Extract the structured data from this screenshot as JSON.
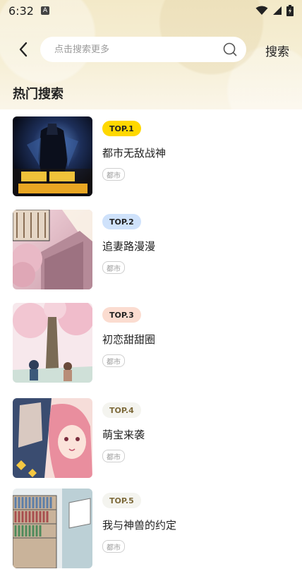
{
  "status_bar": {
    "time": "6:32",
    "notification_badge": "A"
  },
  "header": {
    "back_icon": "chevron-left-icon",
    "search_placeholder": "点击搜索更多",
    "search_icon": "search-icon",
    "search_button_label": "搜索"
  },
  "section": {
    "title": "热门搜索"
  },
  "hot_list": [
    {
      "rank": "TOP.1",
      "title": "都市无敌战神",
      "tag": "都市",
      "rank_bg": "#ffd800",
      "rank_color": "#222222"
    },
    {
      "rank": "TOP.2",
      "title": "追妻路漫漫",
      "tag": "都市",
      "rank_bg": "#cfe2fb",
      "rank_color": "#222222"
    },
    {
      "rank": "TOP.3",
      "title": "初恋甜甜圈",
      "tag": "都市",
      "rank_bg": "#fbdcd0",
      "rank_color": "#222222"
    },
    {
      "rank": "TOP.4",
      "title": "萌宝来袭",
      "tag": "都市",
      "rank_bg": "#f4f4ef",
      "rank_color": "#7d6a3a"
    },
    {
      "rank": "TOP.5",
      "title": "我与神兽的约定",
      "tag": "都市",
      "rank_bg": "#f4f4ef",
      "rank_color": "#7d6a3a"
    }
  ]
}
